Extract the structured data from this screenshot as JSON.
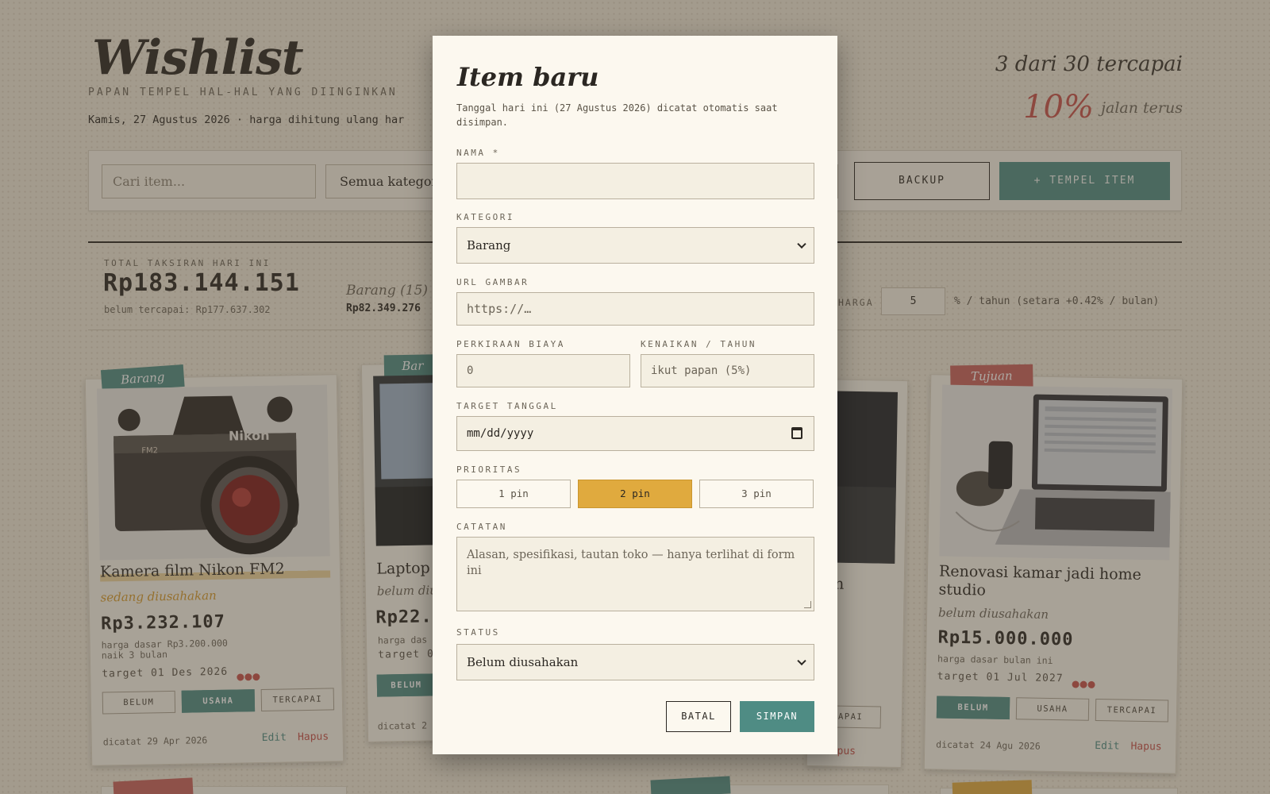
{
  "header": {
    "title": "Wishlist",
    "subtitle": "PAPAN TEMPEL HAL-HAL YANG DIINGINKAN",
    "date_line": "Kamis, 27 Agustus 2026 · harga dihitung ulang har",
    "progress_count": "3 dari 30 tercapai",
    "progress_percent": "10%",
    "progress_note": "jalan terus"
  },
  "toolbar": {
    "search_placeholder": "Cari item...",
    "category_value": "Semua kategori",
    "sort_chevron": "⌄",
    "backup_label": "BACKUP",
    "add_label": "+ TEMPEL ITEM"
  },
  "stats": {
    "total_label": "TOTAL TAKSIRAN HARI INI",
    "total_value": "Rp183.144.151",
    "remaining": "belum tercapai: Rp177.637.302",
    "category_label": "Barang (15)",
    "category_value": "Rp82.349.276",
    "increase_label": "HARGA",
    "increase_value": "5",
    "increase_note": "% / tahun (setara +0.42% / bulan)"
  },
  "cards": [
    {
      "tag": "Barang",
      "title": "Kamera film Nikon FM2",
      "status": "sedang diusahakan",
      "price": "Rp3.232.107",
      "base_price": "harga dasar Rp3.200.000",
      "age": "naik 3 bulan",
      "target": "target 01 Des 2026",
      "buttons": [
        "BELUM",
        "USAHA",
        "TERCAPAI"
      ],
      "recorded": "dicatat 29 Apr 2026",
      "edit": "Edit",
      "delete": "Hapus"
    },
    {
      "tag": "Bar",
      "title": "Laptop",
      "status": "belum diu",
      "price": "Rp22.",
      "base_price": "harga das",
      "target": "target 0",
      "buttons": [
        "BELUM"
      ],
      "recorded": "dicatat 2"
    },
    {
      "title": "atan",
      "buttons": [
        "RCAPAI"
      ],
      "delete_part": "t",
      "delete": "Hapus"
    },
    {
      "tag": "Tujuan",
      "title": "Renovasi kamar jadi home studio",
      "status": "belum diusahakan",
      "price": "Rp15.000.000",
      "base_price": "harga dasar bulan ini",
      "target": "target 01 Jul 2027",
      "buttons": [
        "BELUM",
        "USAHA",
        "TERCAPAI"
      ],
      "recorded": "dicatat 24 Agu 2026",
      "edit": "Edit",
      "delete": "Hapus"
    }
  ],
  "modal": {
    "title": "Item baru",
    "note": "Tanggal hari ini (27 Agustus 2026) dicatat otomatis saat disimpan.",
    "name_label": "NAMA *",
    "name_value": "",
    "category_label": "KATEGORI",
    "category_value": "Barang",
    "image_label": "URL GAMBAR",
    "image_placeholder": "https://…",
    "cost_label": "PERKIRAAN BIAYA",
    "cost_placeholder": "0",
    "increase_label": "KENAIKAN / TAHUN",
    "increase_placeholder": "ikut papan (5%)",
    "target_label": "TARGET TANGGAL",
    "target_placeholder": "mm/dd/yyyy",
    "priority_label": "PRIORITAS",
    "priority_options": [
      "1 pin",
      "2 pin",
      "3 pin"
    ],
    "priority_selected": "2 pin",
    "notes_label": "CATATAN",
    "notes_placeholder": "Alasan, spesifikasi, tautan toko — hanya terlihat di form ini",
    "status_label": "STATUS",
    "status_value": "Belum diusahakan",
    "cancel_label": "BATAL",
    "save_label": "SIMPAN"
  },
  "colors": {
    "accent_teal": "#4f8c84",
    "accent_red": "#c6504a",
    "accent_gold": "#e0aa3e",
    "paper": "#fcf8ef"
  }
}
